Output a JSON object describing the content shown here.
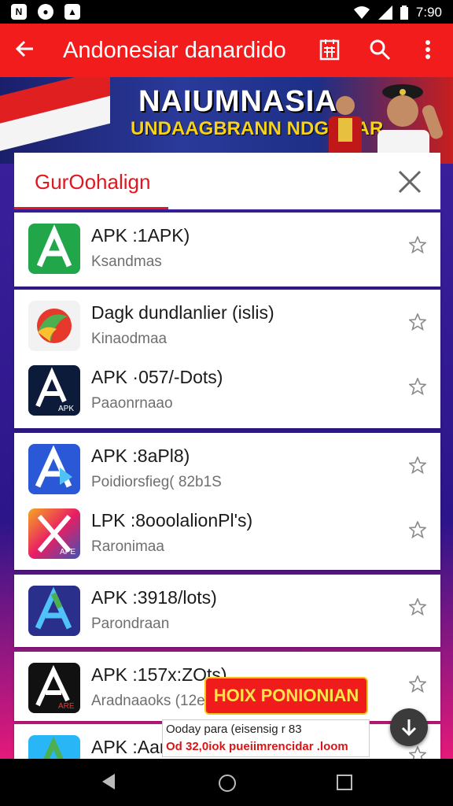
{
  "status_bar": {
    "time": "7:90",
    "left_icons": [
      "notification-n-icon",
      "notification-record-icon",
      "notification-image-icon"
    ],
    "right_icons": [
      "wifi-icon",
      "signal-icon",
      "battery-icon"
    ]
  },
  "app_bar": {
    "title": "Andonesiar danardido",
    "back_icon": "arrow-back-icon",
    "actions": [
      "calendar-icon",
      "search-icon",
      "more-vert-icon"
    ],
    "color": "#f21c1c"
  },
  "banner": {
    "line1": "NAIUMNASIA",
    "line2": "UNDAAGBRANN NDGNDAR"
  },
  "dialog": {
    "title": "GurOohalign",
    "accent": "#e2161f"
  },
  "apps": [
    {
      "title": "APK :1APK)",
      "subtitle": "Ksandmas",
      "icon": "green-apk-icon"
    },
    {
      "title": "Dagk dundlanlier (islis)",
      "subtitle": "Kinaodmaa",
      "icon": "color-swirl-apk-icon"
    },
    {
      "title": "APK ·057/-Dots)",
      "subtitle": "Paaonrnaao",
      "icon": "dark-apk-icon",
      "badge": "APK"
    },
    {
      "title": "APK :8aPl8)",
      "subtitle": "Poidiorsfieg( 82b1S",
      "icon": "blue-apk-icon"
    },
    {
      "title": "LPK :8ooolalionPl's)",
      "subtitle": "Raronimaa",
      "icon": "gradient-apk-icon",
      "badge": "APE"
    },
    {
      "title": "APK :3918/lots)",
      "subtitle": "Parondraan",
      "icon": "navy-apk-icon"
    },
    {
      "title": "APK :157x:ZOts)",
      "subtitle": "Aradnaaoks (12e",
      "icon": "black-apk-icon",
      "badge": "ARE"
    },
    {
      "title": "APK :Aan",
      "subtitle": "",
      "icon": "partial-apk-icon"
    }
  ],
  "promo": {
    "label": "HOIX PONIONIAN"
  },
  "snackbar": {
    "line1": "Ooday para (eisensig r      83",
    "line2": "Od 32,0iok pueiimrencidar .loom"
  },
  "fab_icon": "download-icon",
  "nav_bar": [
    "back-triangle-icon",
    "home-circle-icon",
    "recents-square-icon"
  ]
}
